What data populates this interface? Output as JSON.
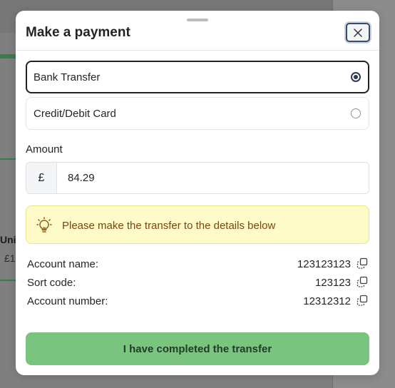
{
  "background": {
    "partial_text_1": "Unit",
    "partial_text_2": "£1"
  },
  "modal": {
    "title": "Make a payment",
    "close_icon": "close-icon",
    "payment_methods": [
      {
        "label": "Bank Transfer",
        "selected": true
      },
      {
        "label": "Credit/Debit Card",
        "selected": false
      }
    ],
    "amount": {
      "label": "Amount",
      "currency_symbol": "£",
      "value": "84.29"
    },
    "notice": {
      "icon": "lightbulb-icon",
      "text": "Please make the transfer to the details below"
    },
    "details": [
      {
        "label": "Account name:",
        "value": "123123123",
        "icon": "copy-icon"
      },
      {
        "label": "Sort code:",
        "value": "123123",
        "icon": "copy-icon"
      },
      {
        "label": "Account number:",
        "value": "12312312",
        "icon": "copy-icon"
      }
    ],
    "submit_label": "I have completed the transfer"
  },
  "colors": {
    "primary_button": "#7bc47f",
    "notice_bg": "#fefbc9",
    "notice_text": "#7a4612",
    "overlay": "#7f7f7f"
  }
}
